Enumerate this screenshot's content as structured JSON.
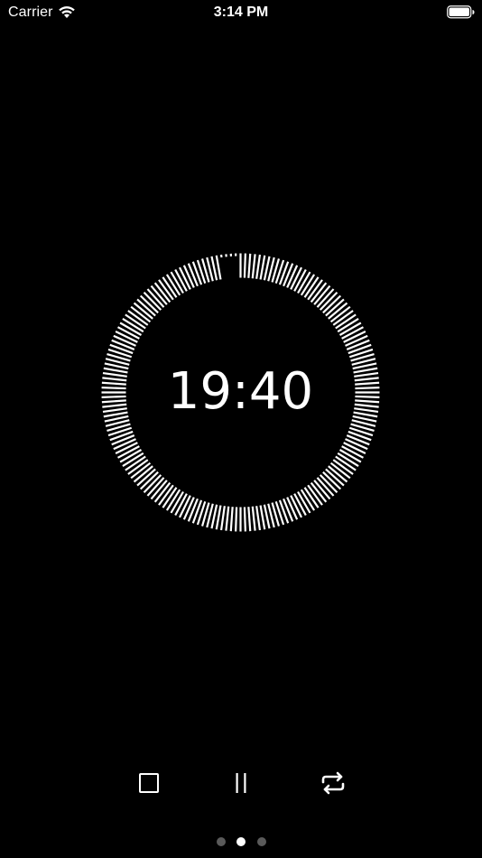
{
  "status_bar": {
    "carrier": "Carrier",
    "time": "3:14 PM",
    "wifi_icon": "wifi-icon",
    "battery_icon": "battery-icon",
    "battery_level": 1.0
  },
  "timer": {
    "display": "19:40",
    "dial_ticks_total": 180,
    "progress_remaining": 0.98
  },
  "controls": [
    {
      "icon": "stop-icon"
    },
    {
      "icon": "pause-icon"
    },
    {
      "icon": "repeat-icon"
    }
  ],
  "pager": {
    "count": 3,
    "active_index": 1
  },
  "colors": {
    "background": "#000000",
    "foreground": "#ffffff",
    "dot_inactive": "#5a5a5a",
    "dot_active": "#ffffff"
  }
}
